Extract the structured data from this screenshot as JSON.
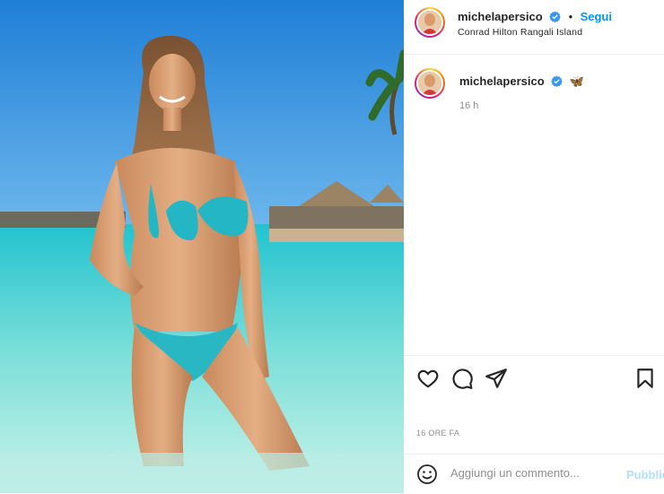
{
  "post": {
    "username": "michelapersico",
    "follow_label": "Segui",
    "dot": "•",
    "location": "Conrad Hilton Rangali Island",
    "caption_emoji": "🦋",
    "caption_time": "16 h",
    "date_label": "16 ORE FA"
  },
  "comment": {
    "placeholder": "Aggiungi un commento...",
    "publish_label": "Pubblica"
  },
  "icons": {
    "like": "heart-icon",
    "comment": "comment-icon",
    "share": "share-icon",
    "save": "bookmark-icon",
    "emoji": "emoji-icon",
    "verified": "verified-badge-icon"
  },
  "colors": {
    "accent": "#0095f6",
    "publish_disabled": "#b2dffc",
    "text": "#262626",
    "muted": "#8e8e8e"
  }
}
